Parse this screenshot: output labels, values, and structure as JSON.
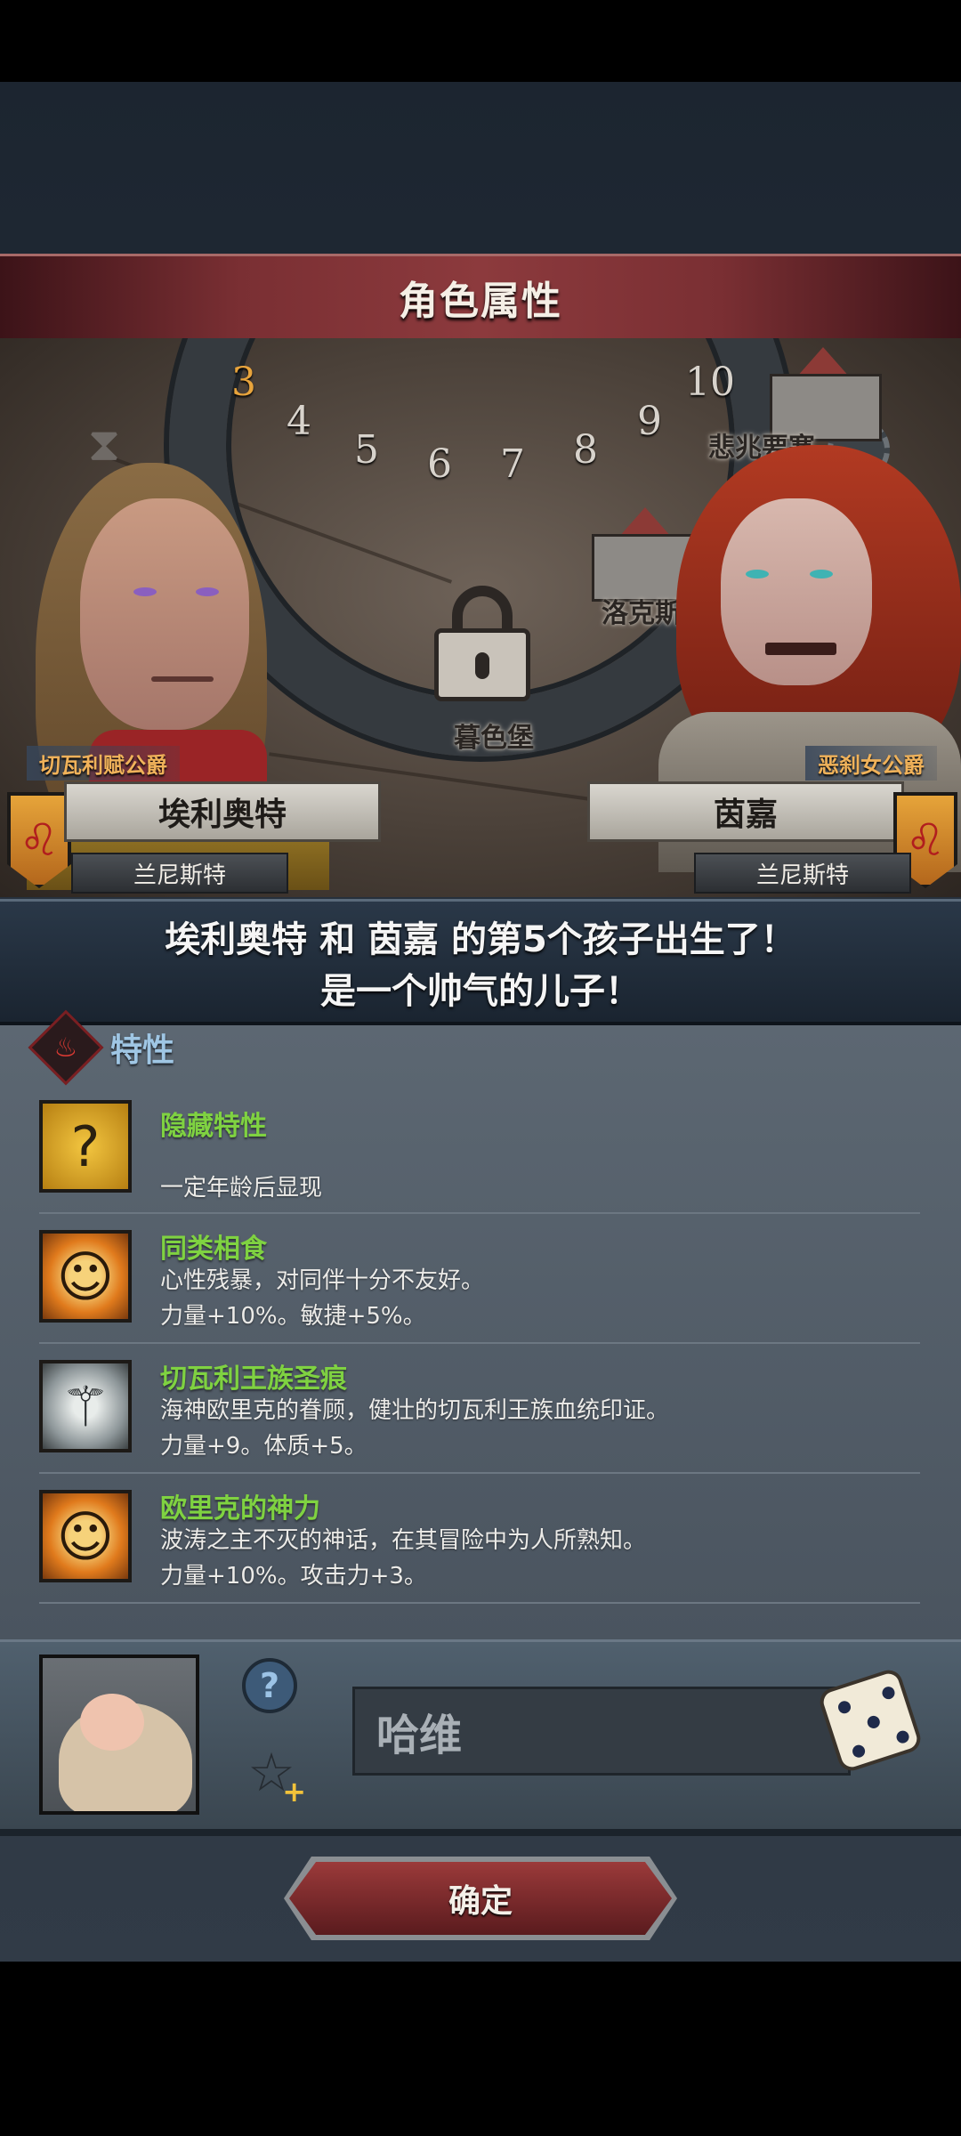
{
  "header": {
    "title": "角色属性"
  },
  "scene": {
    "timeline_numbers": [
      "3",
      "4",
      "5",
      "6",
      "7",
      "8",
      "9",
      "10"
    ],
    "timeline_highlight": "3",
    "places": [
      "悲兆要塞",
      "洛克斯堡",
      "暮色堡"
    ]
  },
  "father": {
    "title": "切瓦利赋公爵",
    "name": "埃利奥特",
    "house": "兰尼斯特"
  },
  "mother": {
    "title": "恶刹女公爵",
    "name": "茵嘉",
    "house": "兰尼斯特"
  },
  "announcement": {
    "line1": "埃利奥特 和 茵嘉 的第5个孩子出生了！",
    "line2": "是一个帅气的儿子！"
  },
  "traits_section": {
    "label": "特性",
    "items": [
      {
        "name": "隐藏特性",
        "desc1": "",
        "desc2": "一定年龄后显现",
        "icon": "question-icon",
        "color": "#d9a52a"
      },
      {
        "name": "同类相食",
        "desc1": "心性残暴，对同伴十分不友好。",
        "desc2": "力量+10%。敏捷+5%。",
        "icon": "smiley-face-icon",
        "color": "#e07a1c"
      },
      {
        "name": "切瓦利王族圣痕",
        "desc1": "海神欧里克的眷顾，健壮的切瓦利王族血统印证。",
        "desc2": "力量+9。体质+5。",
        "icon": "trident-sigil-icon",
        "color": "#9aa3a6"
      },
      {
        "name": "欧里克的神力",
        "desc1": "波涛之主不灭的神话，在其冒险中为人所熟知。",
        "desc2": "力量+10%。攻击力+3。",
        "icon": "smiley-face-icon",
        "color": "#e07a1c"
      }
    ]
  },
  "child": {
    "name_value": "哈维"
  },
  "confirm_label": "确定"
}
